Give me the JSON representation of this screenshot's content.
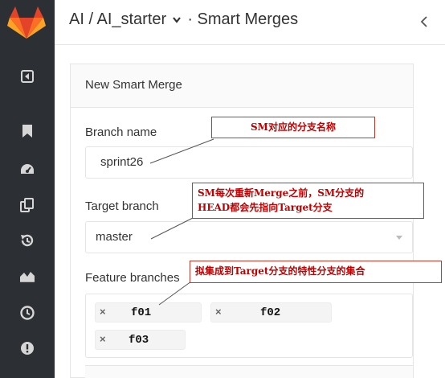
{
  "sidebar": {
    "brand": "gitlab-logo",
    "icons": [
      "sidebar-toggle-icon",
      "bookmark-icon",
      "dashboard-icon",
      "copy-icon",
      "history-icon",
      "graph-icon",
      "clock-icon",
      "alert-icon"
    ]
  },
  "header": {
    "group": "AI",
    "separator": "/",
    "project": "AI_starter",
    "dot": "·",
    "page": "Smart Merges"
  },
  "form": {
    "title": "New Smart Merge",
    "branch_name_label": "Branch name",
    "branch_name_value": "sprint26",
    "target_branch_label": "Target branch",
    "target_branch_value": "master",
    "feature_branches_label": "Feature branches",
    "feature_branches": [
      "f01",
      "f02",
      "f03"
    ],
    "remove_glyph": "×"
  },
  "annotations": {
    "note1": "SM对应的分支名称",
    "note2_line1": "SM每次重新Merge之前，SM分支的",
    "note2_line2": "HEAD都会先指向Target分支",
    "note3": "拟集成到Target分支的特性分支的集合"
  },
  "colors": {
    "sidebar": "#2c3034",
    "annotation_border": "#c0392b",
    "annotation_text": "#c00000",
    "logo_orange": "#e24329",
    "logo_light": "#fca326",
    "logo_mid": "#fc6d26"
  }
}
